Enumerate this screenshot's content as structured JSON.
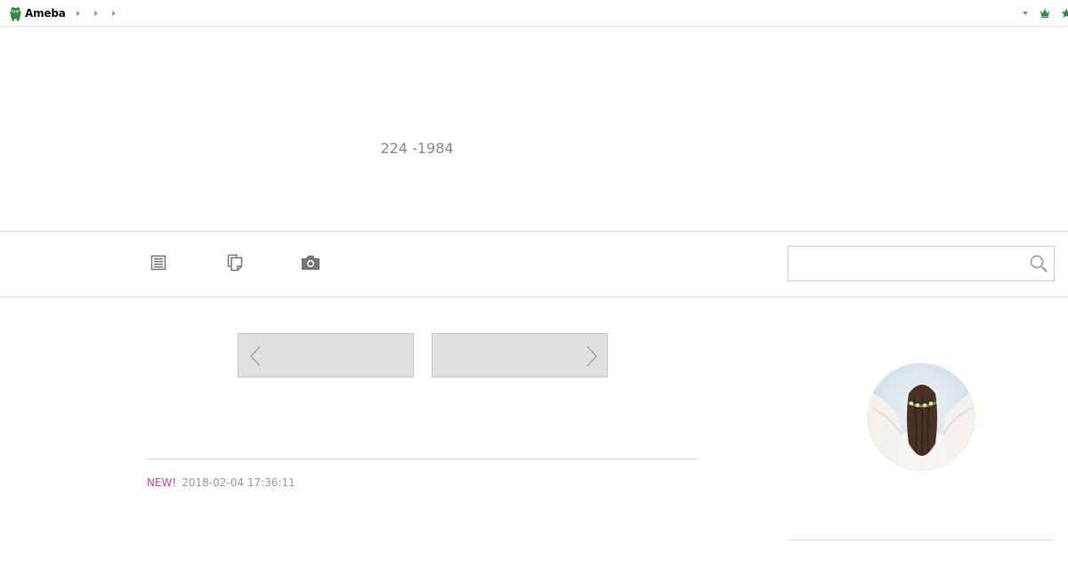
{
  "header": {
    "logo_text": "Ameba",
    "breadcrumb_count": 3
  },
  "blog": {
    "title": "224 -1984"
  },
  "nav": {
    "items": [
      "entries-list-icon",
      "theme-list-icon",
      "photo-camera-icon"
    ]
  },
  "search": {
    "value": "",
    "placeholder": ""
  },
  "entry": {
    "new_label": "NEW!",
    "date": "2018-02-04 17:36:11"
  },
  "colors": {
    "brand_green": "#2d8c3c",
    "new_badge": "#d1409a",
    "muted_text": "#999999"
  }
}
